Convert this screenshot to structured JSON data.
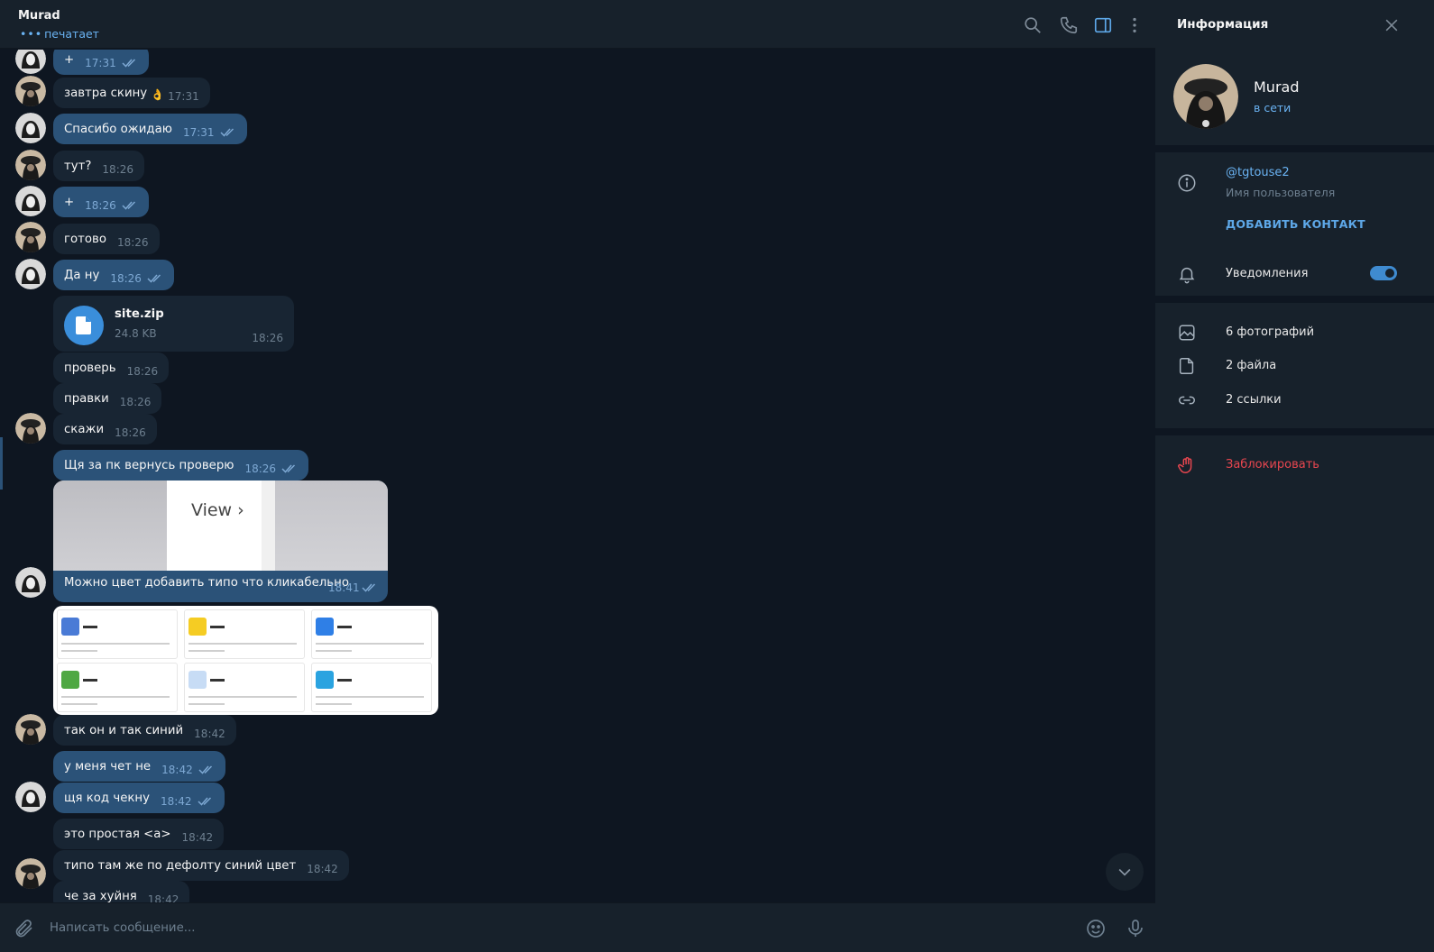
{
  "header": {
    "title": "Murad",
    "status": "печатает",
    "status_dots": "•••"
  },
  "messages": [
    {
      "dir": "out",
      "text": "+",
      "time": "17:31",
      "read": true
    },
    {
      "dir": "in",
      "text": "завтра скину",
      "time": "17:31",
      "emoji": "👌"
    },
    {
      "dir": "out",
      "text": "Спасибо ожидаю",
      "time": "17:31",
      "read": true
    },
    {
      "dir": "in",
      "text": "тут?",
      "time": "18:26"
    },
    {
      "dir": "out",
      "text": "+",
      "time": "18:26",
      "read": true
    },
    {
      "dir": "in",
      "text": "готово",
      "time": "18:26"
    },
    {
      "dir": "out",
      "text": "Да ну",
      "time": "18:26",
      "read": true
    },
    {
      "dir": "in",
      "text": "проверь",
      "time": "18:26"
    },
    {
      "dir": "in",
      "text": "правки",
      "time": "18:26"
    },
    {
      "dir": "in",
      "text": "скажи",
      "time": "18:26"
    },
    {
      "dir": "out",
      "text": "Щя за пк вернусь проверю",
      "time": "18:26",
      "read": true
    },
    {
      "dir": "in",
      "text": "так он и так синий",
      "time": "18:42"
    },
    {
      "dir": "out",
      "text": "у меня чет не",
      "time": "18:42",
      "read": true
    },
    {
      "dir": "out",
      "text": "щя код чекну",
      "time": "18:42",
      "read": true
    },
    {
      "dir": "in",
      "text": "это простая <a>",
      "time": "18:42"
    },
    {
      "dir": "in",
      "text": "типо там же по дефолту синий цвет",
      "time": "18:42"
    },
    {
      "dir": "in",
      "text": "че за хуйня",
      "time": "18:42"
    }
  ],
  "file": {
    "name": "site.zip",
    "size": "24.8 KB",
    "time": "18:26"
  },
  "photo": {
    "view_label": "View ›",
    "caption": "Можно цвет добавить типо что кликабельно",
    "time": "18:41"
  },
  "composer": {
    "placeholder": "Написать сообщение..."
  },
  "info": {
    "title": "Информация",
    "name": "Murad",
    "online": "в сети",
    "username": "@tgtouse2",
    "username_label": "Имя пользователя",
    "add_contact": "ДОБАВИТЬ КОНТАКТ",
    "notifications": "Уведомления",
    "notifications_on": true,
    "photos": "6 фотографий",
    "files": "2 файла",
    "links": "2 ссылки",
    "block": "Заблокировать"
  },
  "colors": {
    "bg": "#0e1621",
    "panel": "#17212b",
    "bubble_in": "#182533",
    "bubble_out": "#2b5278",
    "accent": "#6ab3f3",
    "danger": "#e8464f"
  },
  "icons": [
    "search-icon",
    "phone-icon",
    "sidebar-icon",
    "more-icon",
    "close-icon",
    "info-icon",
    "bell-icon",
    "photo-icon",
    "file-icon",
    "link-icon",
    "hand-icon",
    "attach-icon",
    "emoji-icon",
    "mic-icon",
    "chevron-down-icon",
    "double-check-icon"
  ]
}
